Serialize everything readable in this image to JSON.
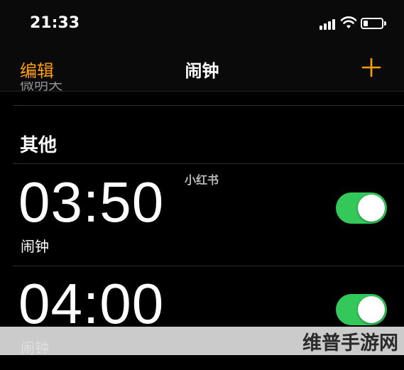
{
  "status_bar": {
    "time": "21:33",
    "icons": [
      "cellular-signal-icon",
      "wifi-icon",
      "battery-icon"
    ]
  },
  "nav": {
    "edit_label": "编辑",
    "title": "闹钟",
    "add_icon": "plus-icon"
  },
  "list": {
    "cut_off_label": "微明天",
    "section_header": "其他",
    "alarms": [
      {
        "time": "03:50",
        "label": "闹钟",
        "enabled": true
      },
      {
        "time": "04:00",
        "label": "闹钟",
        "enabled": true
      }
    ]
  },
  "watermarks": {
    "center": "小红书",
    "bottom": "维普手游网"
  },
  "colors": {
    "accent": "#ff9f0a",
    "toggle_on": "#34c759",
    "background": "#000000",
    "separator": "#2c2c2e"
  }
}
